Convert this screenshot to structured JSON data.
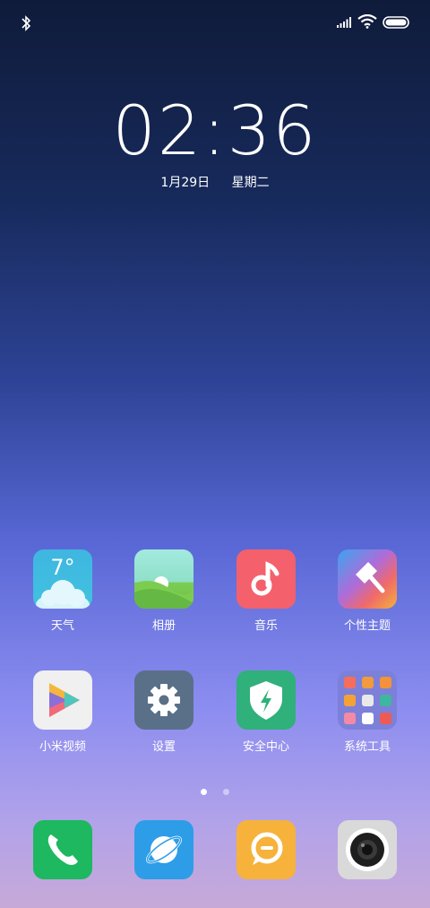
{
  "status_bar": {
    "bluetooth": "bluetooth-icon",
    "signal": "signal-icon",
    "wifi": "wifi-icon",
    "battery": "battery-icon"
  },
  "lockscreen": {
    "time": "02:36",
    "date": "1月29日",
    "weekday": "星期二"
  },
  "apps": [
    {
      "label": "天气",
      "icon": "weather-icon",
      "temp": "7°"
    },
    {
      "label": "相册",
      "icon": "gallery-icon"
    },
    {
      "label": "音乐",
      "icon": "music-icon"
    },
    {
      "label": "个性主题",
      "icon": "theme-icon"
    },
    {
      "label": "小米视频",
      "icon": "video-icon"
    },
    {
      "label": "设置",
      "icon": "settings-icon"
    },
    {
      "label": "安全中心",
      "icon": "security-icon"
    },
    {
      "label": "系统工具",
      "icon": "folder-icon"
    }
  ],
  "page_indicator": {
    "pages": 2,
    "current": 1
  },
  "dock": [
    {
      "icon": "phone-icon"
    },
    {
      "icon": "browser-icon"
    },
    {
      "icon": "messages-icon"
    },
    {
      "icon": "camera-icon"
    }
  ],
  "colors": {
    "weather": "#3fb6e0",
    "music": "#f4606b",
    "settings": "#5a7089",
    "security": "#30b07a",
    "phone": "#1db85f",
    "browser": "#2d9de8",
    "messages": "#f6b23b"
  }
}
